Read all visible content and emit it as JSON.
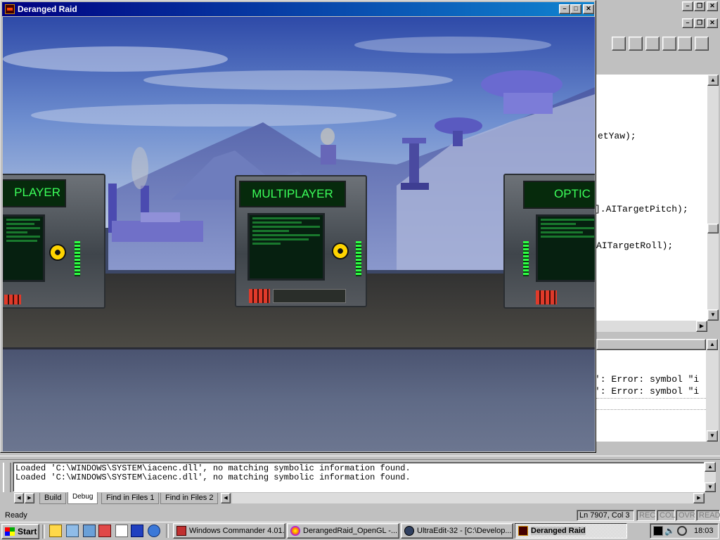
{
  "game_window": {
    "title": "Deranged Raid",
    "menus": [
      "PLAYER",
      "MULTIPLAYER",
      "OPTIC"
    ]
  },
  "ide": {
    "code_lines": [
      "etYaw);",
      "].AITargetPitch);",
      "AITargetRoll);"
    ],
    "error_lines": [
      "': Error: symbol \"i",
      "': Error: symbol \"i"
    ],
    "output_lines": [
      "Loaded 'C:\\WINDOWS\\SYSTEM\\iacenc.dll', no matching symbolic information found.",
      "Loaded 'C:\\WINDOWS\\SYSTEM\\iacenc.dll', no matching symbolic information found."
    ],
    "tabs": [
      "Build",
      "Debug",
      "Find in Files 1",
      "Find in Files 2"
    ],
    "active_tab": "Debug",
    "status": {
      "text": "Ready",
      "position": "Ln 7907, Col 3",
      "indicators": [
        "REC",
        "COL",
        "OVR",
        "READ"
      ]
    }
  },
  "taskbar": {
    "start_label": "Start",
    "buttons": [
      {
        "label": "Windows Commander 4.01...",
        "icon": "disk-icon"
      },
      {
        "label": "DerangedRaid_OpenGL -...",
        "icon": "opengl-icon"
      },
      {
        "label": "UltraEdit-32 - [C:\\Develop...",
        "icon": "ultraedit-icon"
      },
      {
        "label": "Deranged Raid",
        "icon": "game-icon"
      }
    ],
    "clock": "18:03"
  },
  "colors": {
    "title_active": "#000080",
    "desktop_gray": "#c0c0c0",
    "terminal_green": "#3cff5a"
  }
}
